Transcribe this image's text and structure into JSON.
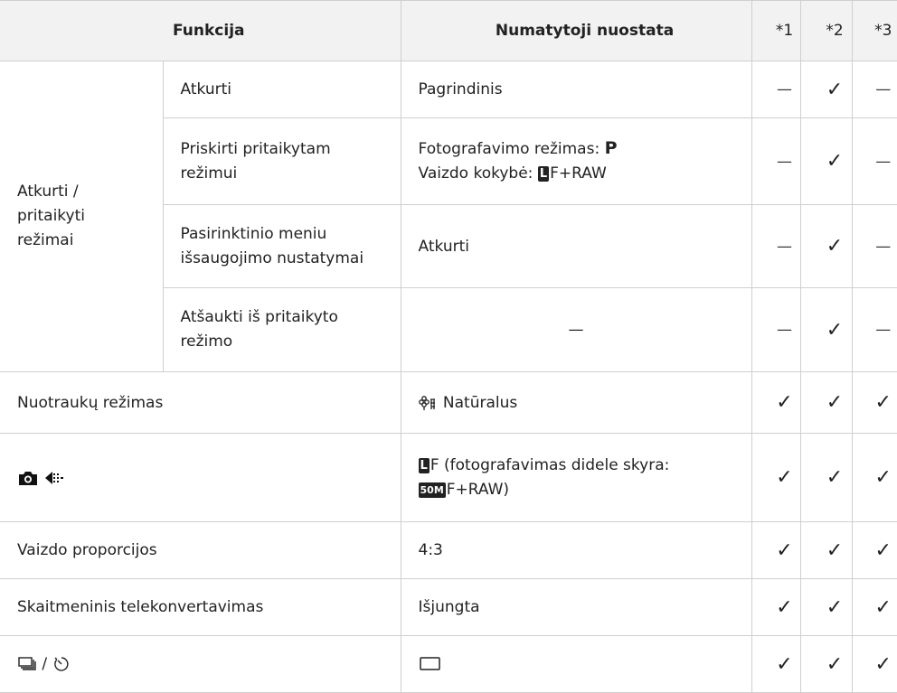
{
  "header": {
    "function": "Funkcija",
    "default": "Numatytoji nuostata",
    "col1": "*1",
    "col2": "*2",
    "col3": "*3"
  },
  "group": {
    "label_line1": "Atkurti /",
    "label_line2": "pritaikyti",
    "label_line3": "režimai"
  },
  "rows": {
    "r1": {
      "name": "Atkurti",
      "value": "Pagrindinis",
      "m1": "—",
      "m2": "✓",
      "m3": "—"
    },
    "r2": {
      "name_line1": "Priskirti pritaikytam",
      "name_line2": "režimui",
      "value_line1": "Fotografavimo režimas: ",
      "value_line1_bold": "P",
      "value_line2": "Vaizdo kokybė: ",
      "value_line2_badge": "L",
      "value_line2_suffix": "F+RAW",
      "m1": "—",
      "m2": "✓",
      "m3": "—"
    },
    "r3": {
      "name_line1": "Pasirinktinio meniu",
      "name_line2": "išsaugojimo nustatymai",
      "value": "Atkurti",
      "m1": "—",
      "m2": "✓",
      "m3": "—"
    },
    "r4": {
      "name_line1": "Atšaukti iš pritaikyto",
      "name_line2": "režimo",
      "value": "—",
      "m1": "—",
      "m2": "✓",
      "m3": "—"
    },
    "r5": {
      "name": "Nuotraukų režimas",
      "value_icon": "picture-mode-natural-icon",
      "value": "Natūralus",
      "m1": "✓",
      "m2": "✓",
      "m3": "✓"
    },
    "r6": {
      "name_icons": [
        "camera-icon",
        "image-quality-icon"
      ],
      "value_line1_badge": "L",
      "value_line1": "F (fotografavimas didele skyra:",
      "value_line2_badge": "50M",
      "value_line2": "F+RAW)",
      "m1": "✓",
      "m2": "✓",
      "m3": "✓"
    },
    "r7": {
      "name": "Vaizdo proporcijos",
      "value": "4:3",
      "m1": "✓",
      "m2": "✓",
      "m3": "✓"
    },
    "r8": {
      "name": "Skaitmeninis telekonvertavimas",
      "value": "Išjungta",
      "m1": "✓",
      "m2": "✓",
      "m3": "✓"
    },
    "r9": {
      "name_icons": [
        "sequential-shooting-icon",
        "self-timer-icon"
      ],
      "name_separator": "/",
      "value_icon": "single-frame-icon",
      "m1": "✓",
      "m2": "✓",
      "m3": "✓"
    }
  }
}
